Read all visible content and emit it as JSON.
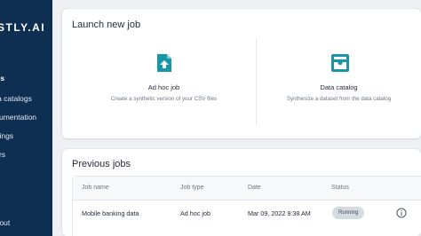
{
  "brand": {
    "logo_text": "STLY.AI"
  },
  "sidebar": {
    "items": [
      {
        "label": "obs",
        "active": true
      },
      {
        "label": "ata catalogs",
        "active": false
      },
      {
        "label": "ocumentation",
        "active": false
      },
      {
        "label": "ettings",
        "active": false
      },
      {
        "label": "sers",
        "active": false
      }
    ],
    "logout_label": "ogout"
  },
  "launch": {
    "title": "Launch new job",
    "adhoc": {
      "title": "Ad hoc job",
      "description": "Create a synthetic version of your CSV files",
      "icon": "file-upload-icon"
    },
    "catalog": {
      "title": "Data catalog",
      "description": "Synthesize a dataset from the data catalog",
      "icon": "inbox-tray-icon"
    }
  },
  "previous": {
    "title": "Previous jobs",
    "columns": {
      "name": "Job name",
      "type": "Job type",
      "date": "Date",
      "status": "Status"
    },
    "rows": [
      {
        "name": "Mobile banking data",
        "type": "Ad hoc job",
        "date": "Mar 09, 2022 9:38 AM",
        "status": "Running"
      }
    ]
  },
  "colors": {
    "sidebar": "#0e2f52",
    "accent_teal": "#1796a8",
    "badge_bg": "#d6dbe2"
  }
}
